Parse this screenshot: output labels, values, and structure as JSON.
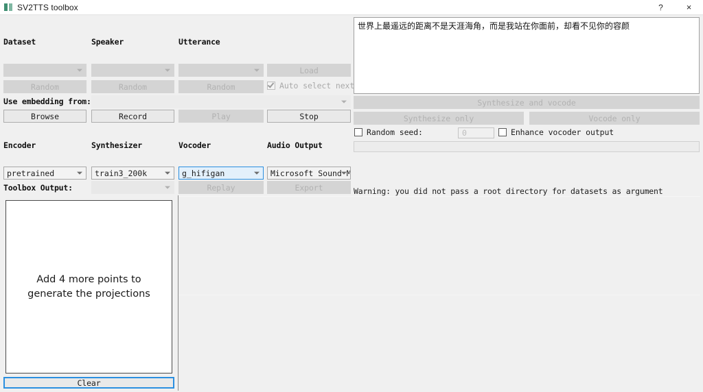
{
  "window": {
    "title": "SV2TTS toolbox",
    "icon": "app-icon",
    "help_label": "?",
    "close_label": "×"
  },
  "browser": {
    "headers": {
      "dataset": "Dataset",
      "speaker": "Speaker",
      "utterance": "Utterance"
    },
    "dataset_value": "",
    "speaker_value": "",
    "utterance_value": "",
    "load_label": "Load",
    "random_dataset_label": "Random",
    "random_speaker_label": "Random",
    "random_utterance_label": "Random",
    "auto_select_label": "Auto select next",
    "auto_select_checked": true,
    "use_embedding_label": "Use embedding from:",
    "use_embedding_value": "",
    "browse_label": "Browse",
    "record_label": "Record",
    "play_label": "Play",
    "stop_label": "Stop"
  },
  "models": {
    "headers": {
      "encoder": "Encoder",
      "synthesizer": "Synthesizer",
      "vocoder": "Vocoder",
      "audio_output": "Audio Output"
    },
    "encoder_value": "pretrained",
    "synthesizer_value": "train3_200k",
    "vocoder_value": "g_hifigan",
    "audio_output_value": "Microsoft Sound Mapper",
    "toolbox_output_label": "Toolbox Output:",
    "toolbox_output_value": "",
    "replay_label": "Replay",
    "export_label": "Export"
  },
  "projection": {
    "message_line1": "Add 4 more points to",
    "message_line2": "generate the projections",
    "clear_label": "Clear"
  },
  "synthesis": {
    "text_value": "世界上最遥远的距离不是天涯海角，而是我站在你面前，却看不见你的容颜",
    "synthesize_and_vocode_label": "Synthesize and vocode",
    "synthesize_only_label": "Synthesize only",
    "vocode_only_label": "Vocode only",
    "random_seed_label": "Random seed:",
    "random_seed_checked": false,
    "seed_placeholder": "0",
    "seed_value": "",
    "enhance_label": "Enhance vocoder output",
    "enhance_checked": false,
    "warning_text": "Warning: you did not pass a root directory for datasets as argument"
  },
  "colors": {
    "window_bg": "#f0f0f0",
    "accent_focus": "#2a8fe0",
    "disabled_text": "#b2b2b2",
    "widget_disabled_bg": "#d4d4d4"
  }
}
